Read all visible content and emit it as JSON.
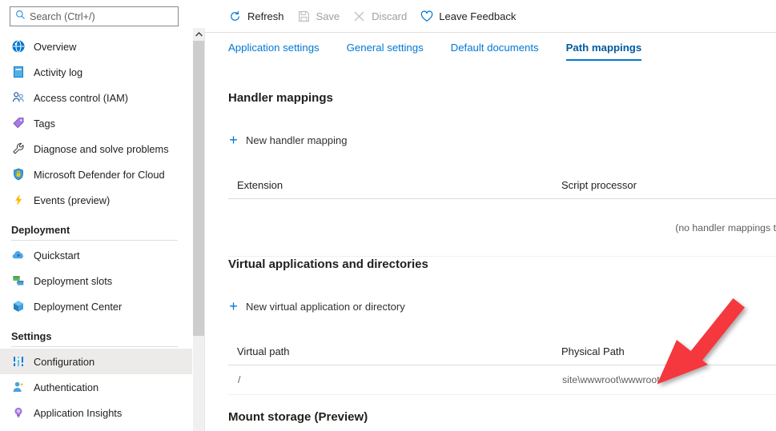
{
  "sidebar": {
    "search": {
      "placeholder": "Search (Ctrl+/)",
      "value": "",
      "icon": "search-icon"
    },
    "collapse_label": "«",
    "items": [
      {
        "label": "Overview",
        "icon": "overview-globe-icon",
        "group": null
      },
      {
        "label": "Activity log",
        "icon": "activity-log-icon",
        "group": null
      },
      {
        "label": "Access control (IAM)",
        "icon": "access-control-icon",
        "group": null
      },
      {
        "label": "Tags",
        "icon": "tag-icon",
        "group": null
      },
      {
        "label": "Diagnose and solve problems",
        "icon": "wrench-icon",
        "group": null
      },
      {
        "label": "Microsoft Defender for Cloud",
        "icon": "shield-icon",
        "group": null
      },
      {
        "label": "Events (preview)",
        "icon": "lightning-bolt-icon",
        "group": null
      }
    ],
    "groups": [
      {
        "title": "Deployment",
        "items": [
          {
            "label": "Quickstart",
            "icon": "quickstart-cloud-icon"
          },
          {
            "label": "Deployment slots",
            "icon": "deployment-slots-icon"
          },
          {
            "label": "Deployment Center",
            "icon": "deployment-center-cube-icon"
          }
        ]
      },
      {
        "title": "Settings",
        "items": [
          {
            "label": "Configuration",
            "icon": "configuration-sliders-icon",
            "selected": true
          },
          {
            "label": "Authentication",
            "icon": "authentication-user-icon",
            "selected": false
          },
          {
            "label": "Application Insights",
            "icon": "app-insights-bulb-icon",
            "selected": false
          }
        ]
      }
    ]
  },
  "toolbar": {
    "buttons": [
      {
        "label": "Refresh",
        "icon": "refresh-icon",
        "disabled": false
      },
      {
        "label": "Save",
        "icon": "save-icon",
        "disabled": true
      },
      {
        "label": "Discard",
        "icon": "discard-icon",
        "disabled": true
      },
      {
        "label": "Leave Feedback",
        "icon": "heart-icon",
        "disabled": false
      }
    ]
  },
  "tabs": [
    {
      "label": "Application settings",
      "active": false
    },
    {
      "label": "General settings",
      "active": false
    },
    {
      "label": "Default documents",
      "active": false
    },
    {
      "label": "Path mappings",
      "active": true
    }
  ],
  "handler_mappings": {
    "title": "Handler mappings",
    "new_link": "New handler mapping",
    "columns": [
      "Extension",
      "Script processor"
    ],
    "empty_message": "(no handler mappings t",
    "rows": []
  },
  "virtual_applications": {
    "title": "Virtual applications and directories",
    "new_link": "New virtual application or directory",
    "columns": [
      "Virtual path",
      "Physical Path"
    ],
    "rows": [
      {
        "virtual_path": "/",
        "physical_path": "site\\wwwroot\\wwwroot"
      }
    ]
  },
  "mount_storage": {
    "title": "Mount storage (Preview)"
  },
  "annotation": {
    "type": "arrow",
    "color": "#F4383C",
    "points_to": "site\\wwwroot\\wwwroot"
  },
  "colors": {
    "accent": "#0078D4",
    "accent_dark": "#005A9E",
    "selected_row": "#EDEBE9",
    "annotation_red": "#F4383C"
  }
}
